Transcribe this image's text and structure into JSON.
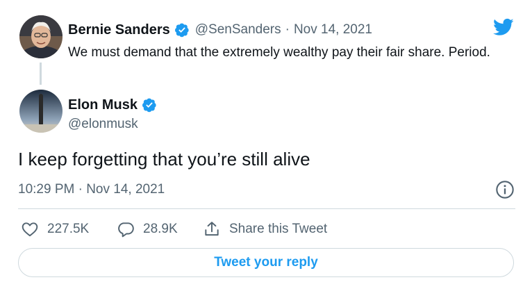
{
  "parent_tweet": {
    "display_name": "Bernie Sanders",
    "handle": "@SenSanders",
    "separator": "·",
    "date": "Nov 14, 2021",
    "text": "We must demand that the extremely wealthy pay their fair share. Period.",
    "avatar_icon": "bernie-avatar",
    "verified_icon": "verified-badge-icon"
  },
  "tweet": {
    "display_name": "Elon Musk",
    "handle": "@elonmusk",
    "text": "I keep forgetting that you’re still alive",
    "timestamp": "10:29 PM · Nov 14, 2021",
    "avatar_icon": "elon-avatar",
    "verified_icon": "verified-badge-icon"
  },
  "actions": {
    "likes": "227.5K",
    "replies": "28.9K",
    "share_label": "Share this Tweet"
  },
  "reply_button_label": "Tweet your reply",
  "colors": {
    "accent": "#1d9bf0",
    "text_primary": "#0f1419",
    "text_secondary": "#536471",
    "border": "#cfd9de"
  }
}
